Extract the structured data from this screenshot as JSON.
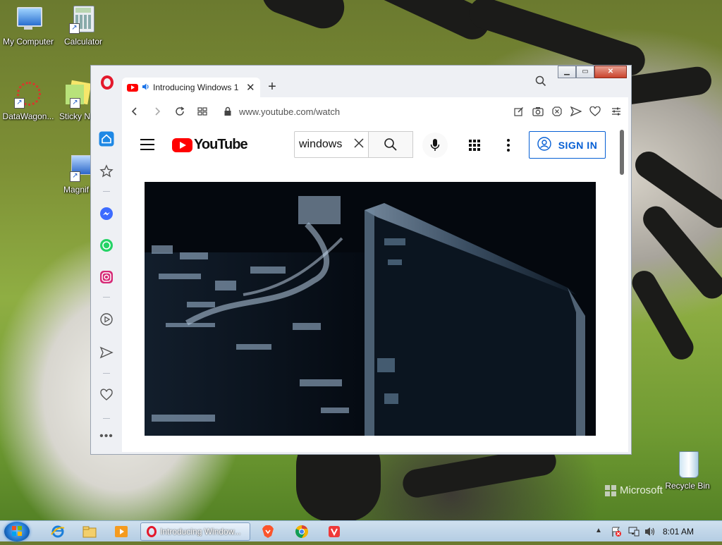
{
  "desktop": {
    "icons": [
      {
        "label": "My Computer"
      },
      {
        "label": "Calculator"
      },
      {
        "label": "DataWagon..."
      },
      {
        "label": "Sticky N"
      },
      {
        "label": "Magnif"
      },
      {
        "label": "Recycle Bin"
      }
    ],
    "watermark": "Microsoft"
  },
  "browser": {
    "tab": {
      "title": "Introducing Windows 1"
    },
    "toolbar": {
      "url": "www.youtube.com/watch"
    },
    "sidebar_icons": [
      "home-icon",
      "star-icon",
      "messenger-icon",
      "whatsapp-icon",
      "instagram-icon",
      "player-icon",
      "send-icon",
      "heart-icon",
      "more-icon"
    ]
  },
  "youtube": {
    "logo_text": "YouTube",
    "search": {
      "value": "windows"
    },
    "sign_in_label": "SIGN IN"
  },
  "taskbar": {
    "active_window_label": "Introducing Window...",
    "clock": "8:01 AM"
  },
  "colors": {
    "opera_red": "#e4182b",
    "youtube_red": "#ff0000",
    "link_blue": "#065fd4"
  }
}
